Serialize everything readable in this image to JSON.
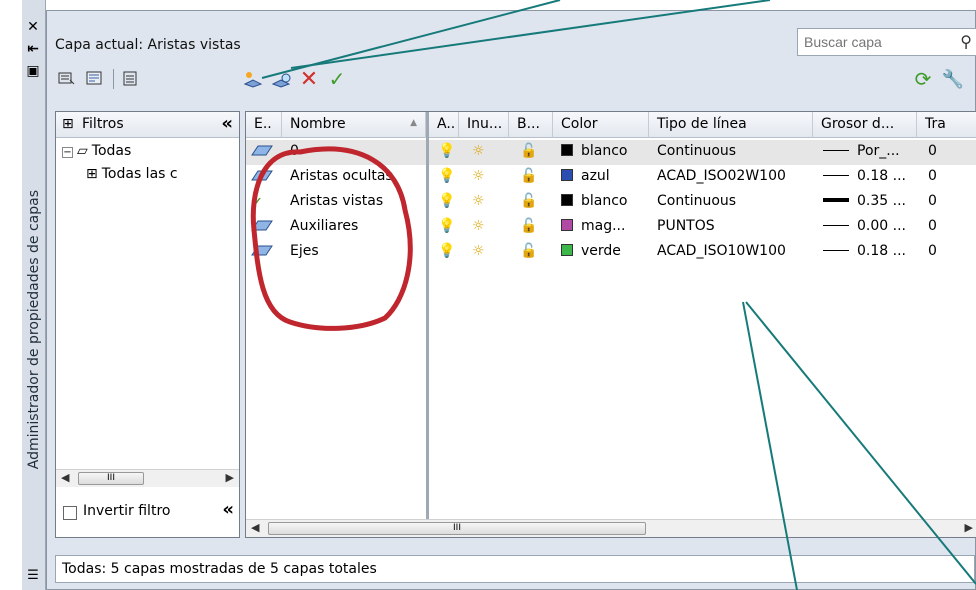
{
  "palette": {
    "accent_teal": "#177a7a",
    "annotation_red": "#c0262d",
    "frame_bg": "#dfe5ee"
  },
  "sidebar": {
    "title": "Administrador de propiedades de capas",
    "close_icon": "close-icon",
    "pin_icon": "autohide-icon",
    "props_icon": "properties-icon",
    "bottom_icon": "layers-icon"
  },
  "header": {
    "current_layer": "Capa actual: Aristas vistas",
    "search_placeholder": "Buscar capa"
  },
  "toolbar": {
    "left_icons": [
      "new-filter-icon",
      "new-group-filter-icon",
      "layer-states-icon"
    ],
    "center_icons": [
      "new-layer-icon",
      "new-layer-frozen-icon",
      "delete-layer-icon",
      "set-current-icon"
    ],
    "right_icons": [
      "refresh-icon",
      "settings-icon"
    ]
  },
  "filters": {
    "header": "Filtros",
    "tree": [
      {
        "label": "Todas",
        "expanded": true
      },
      {
        "label": "Todas las c"
      }
    ],
    "invert_label": "Invertir filtro",
    "invert_checked": false,
    "scroll_glyph": "III"
  },
  "layers": {
    "columns": [
      "E..",
      "Nombre",
      "A..",
      "Inu...",
      "B...",
      "Color",
      "Tipo de línea",
      "Grosor d...",
      "Tra"
    ],
    "rows": [
      {
        "name": "0",
        "status": "layer",
        "color_name": "blanco",
        "color_hex": "#000000",
        "linetype": "Continuous",
        "lineweight": "Por_...",
        "tr": "0",
        "heavy": false,
        "selected": true
      },
      {
        "name": "Aristas ocultas",
        "status": "layer",
        "color_name": "azul",
        "color_hex": "#2a4fb0",
        "linetype": "ACAD_ISO02W100",
        "lineweight": "0.18 ...",
        "tr": "0",
        "heavy": false,
        "selected": false
      },
      {
        "name": "Aristas vistas",
        "status": "current",
        "color_name": "blanco",
        "color_hex": "#000000",
        "linetype": "Continuous",
        "lineweight": "0.35 ...",
        "tr": "0",
        "heavy": true,
        "selected": false
      },
      {
        "name": "Auxiliares",
        "status": "layer",
        "color_name": "mag...",
        "color_hex": "#b04aa5",
        "linetype": "PUNTOS",
        "lineweight": "0.00 ...",
        "tr": "0",
        "heavy": false,
        "selected": false
      },
      {
        "name": "Ejes",
        "status": "layer",
        "color_name": "verde",
        "color_hex": "#3cb84a",
        "linetype": "ACAD_ISO10W100",
        "lineweight": "0.18 ...",
        "tr": "0",
        "heavy": false,
        "selected": false
      }
    ],
    "scroll_glyph": "III"
  },
  "status_bar": {
    "text": "Todas: 5 capas mostradas de 5 capas totales"
  }
}
